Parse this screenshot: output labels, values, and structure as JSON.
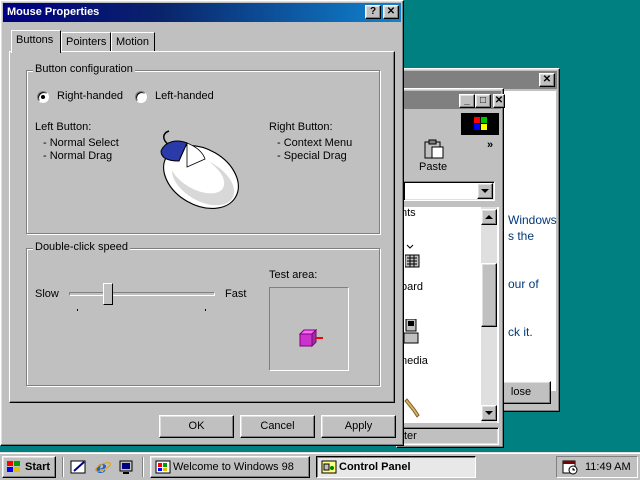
{
  "welcome": {
    "close_glyph": "✕",
    "text_lines": [
      "Windows",
      "s the",
      "our of",
      "ck it."
    ],
    "close_label": "lose"
  },
  "control_panel": {
    "min_glyph": "_",
    "max_glyph": "□",
    "close_glyph": "✕",
    "paste_label": "Paste",
    "more_glyph": "»",
    "items": [
      "nts",
      "oard",
      "nedia"
    ],
    "status": "ter"
  },
  "dialog": {
    "title": "Mouse Properties",
    "help_glyph": "?",
    "close_glyph": "✕",
    "tabs": [
      {
        "label": "Buttons",
        "active": true
      },
      {
        "label": "Pointers",
        "active": false
      },
      {
        "label": "Motion",
        "active": false
      }
    ],
    "button_config": {
      "legend": "Button configuration",
      "right_handed": "Right-handed",
      "left_handed": "Left-handed",
      "selected": "right",
      "left_button_title": "Left Button:",
      "left_button_items": [
        "-  Normal Select",
        "-  Normal Drag"
      ],
      "right_button_title": "Right Button:",
      "right_button_items": [
        "-  Context Menu",
        "-  Special Drag"
      ]
    },
    "double_click": {
      "legend": "Double-click speed",
      "slow": "Slow",
      "fast": "Fast",
      "test_area": "Test area:",
      "slider_value": 0.24
    },
    "buttons": {
      "ok": "OK",
      "cancel": "Cancel",
      "apply": "Apply"
    }
  },
  "taskbar": {
    "start": "Start",
    "tasks": [
      {
        "label": "Welcome to Windows 98",
        "active": false
      },
      {
        "label": "Control Panel",
        "active": true
      }
    ],
    "clock": "11:49 AM"
  },
  "colors": {
    "desktop": "#008080",
    "title_active_start": "#000080",
    "title_active_end": "#1084d0",
    "title_inactive": "#808080",
    "face": "#c0c0c0",
    "test_box": "#cc33cc"
  }
}
